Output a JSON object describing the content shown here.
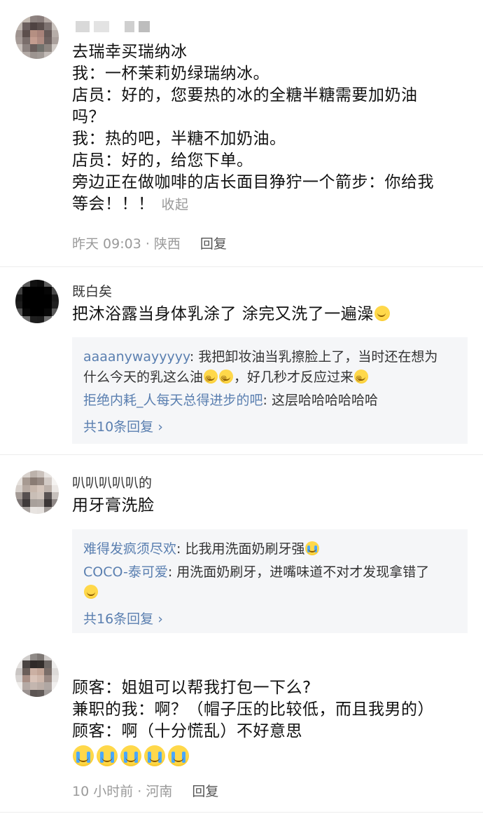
{
  "comments": [
    {
      "username": "",
      "lines": [
        "去瑞幸买瑞纳冰",
        "我：一杯茉莉奶绿瑞纳冰。",
        "店员：好的，您要热的冰的全糖半糖需要加奶油",
        "吗？",
        "我：热的吧，半糖不加奶油。",
        "店员：好的，给您下单。",
        "旁边正在做咖啡的店长面目狰狞一个箭步：你给我",
        "等会！！！"
      ],
      "collapse_label": "收起",
      "time": "昨天 09:03 · 陕西",
      "reply_label": "回复"
    },
    {
      "username": "既白矣",
      "text": "把沐浴露当身体乳涂了 涂完又洗了一遍澡",
      "replies": [
        {
          "user": "aaaanywayyyyy",
          "text_a": "我把卸妆油当乳擦脸上了，当时还在想为",
          "text_b": "什么今天的乳这么油",
          "text_c": "，好几秒才反应过来"
        },
        {
          "user": "拒绝内耗_人每天总得进步的吧",
          "text": "这层哈哈哈哈哈哈"
        }
      ],
      "more_label": "共10条回复 ›"
    },
    {
      "username": "叭叭叭叭叭的",
      "text": "用牙膏洗脸",
      "replies": [
        {
          "user": "难得发疯须尽欢",
          "text": "比我用洗面奶刷牙强"
        },
        {
          "user": "COCO-泰可爱",
          "text": "用洗面奶刷牙，进嘴味道不对才发现拿错了"
        }
      ],
      "more_label": "共16条回复 ›"
    },
    {
      "username": "",
      "lines": [
        "顾客：姐姐可以帮我打包一下么?",
        "兼职的我：啊？（帽子压的比较低，而且我男的）",
        "顾客：啊（十分慌乱）不好意思"
      ],
      "time": "10 小时前 · 河南",
      "reply_label": "回复"
    }
  ],
  "colors": {
    "link_blue": "#5a7fb0",
    "meta_gray": "#9a9a9a",
    "reply_bg": "#f5f6f8"
  },
  "icons": [
    "laugh-cry-emoji",
    "dizzy-emoji",
    "crying-emoji"
  ]
}
